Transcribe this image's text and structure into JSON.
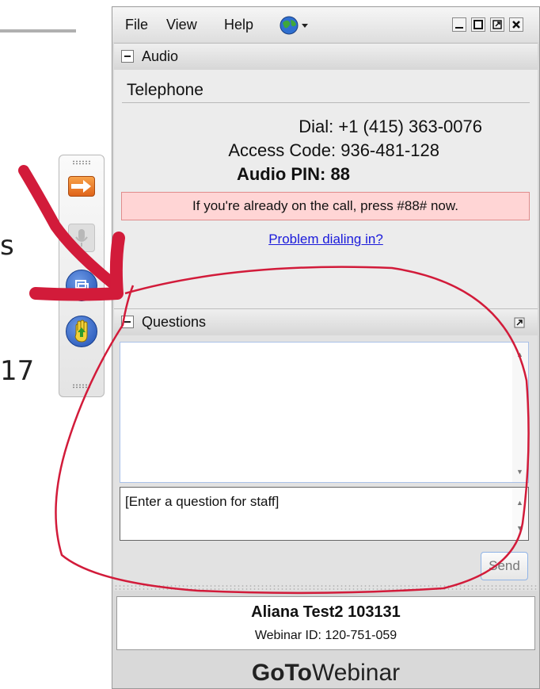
{
  "background": {
    "partial_text_1": "s",
    "partial_text_2": "17"
  },
  "menu": {
    "file": "File",
    "view": "View",
    "help": "Help"
  },
  "audio": {
    "section_title": "Audio",
    "mode": "Telephone",
    "dial_label": "Dial:",
    "dial_value": "+1 (415) 363-0076",
    "access_label": "Access Code:",
    "access_value": "936-481-128",
    "pin_label": "Audio PIN:",
    "pin_value": "88",
    "notice": "If you're already on the call, press #88# now.",
    "problem_link": "Problem dialing in?"
  },
  "questions": {
    "section_title": "Questions",
    "input_placeholder": "[Enter a question for staff]",
    "send_label": "Send"
  },
  "footer": {
    "attendee_name": "Aliana Test2 103131",
    "webinar_id": "Webinar ID: 120-751-059",
    "brand_bold": "GoTo",
    "brand_rest": "Webinar"
  },
  "colors": {
    "notice_bg": "#ffd5d5",
    "link": "#1a1adb",
    "annotation": "#d21b3a"
  }
}
